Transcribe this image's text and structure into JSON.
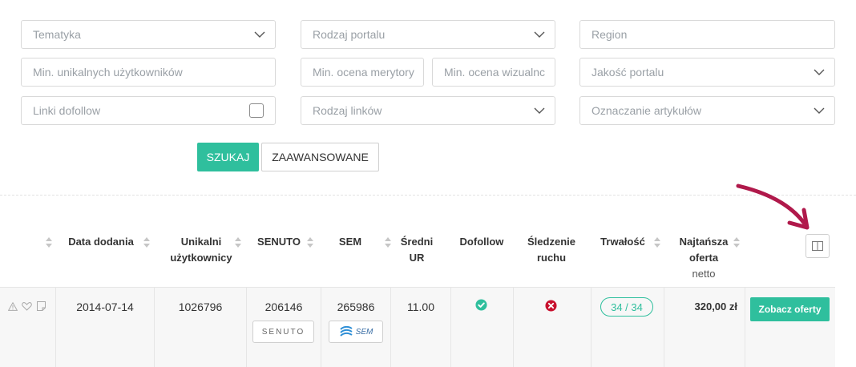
{
  "filters": {
    "tematyka": "Tematyka",
    "rodzaj_portalu": "Rodzaj portalu",
    "region": "Region",
    "min_unikalnych": "Min. unikalnych użytkowników",
    "min_ocena_merytoryczna": "Min. ocena merytory",
    "min_ocena_wizualna": "Min. ocena wizualnc",
    "jakosc_portalu": "Jakość portalu",
    "linki_dofollow": "Linki dofollow",
    "rodzaj_linkow": "Rodzaj linków",
    "oznaczanie_artykulow": "Oznaczanie artykułów"
  },
  "buttons": {
    "search": "SZUKAJ",
    "advanced": "ZAAWANSOWANE"
  },
  "table": {
    "headers": {
      "data_dodania": "Data dodania",
      "unikalni_1": "Unikalni",
      "unikalni_2": "użytkownicy",
      "senuto": "SENUTO",
      "sem": "SEM",
      "sredni_1": "Średni",
      "sredni_2": "UR",
      "dofollow": "Dofollow",
      "sledzenie_1": "Śledzenie",
      "sledzenie_2": "ruchu",
      "trwalosc": "Trwałość",
      "najtansza_1": "Najtańsza",
      "najtansza_2": "oferta",
      "najtansza_3": "netto"
    },
    "row": {
      "date": "2014-07-14",
      "unique_users": "1026796",
      "senuto": "206146",
      "senuto_logo": "SENUTO",
      "sem": "265986",
      "sem_logo": "SEM",
      "avg_ur": "11.00",
      "dofollow": "check-circle-icon",
      "tracking": "x-circle-icon",
      "durability": "34 / 34",
      "price": "320,00 zł",
      "offer_button": "Zobacz oferty"
    }
  },
  "colors": {
    "accent": "#2fbf9d",
    "danger": "#c8102e",
    "arrow": "#b0194b"
  }
}
